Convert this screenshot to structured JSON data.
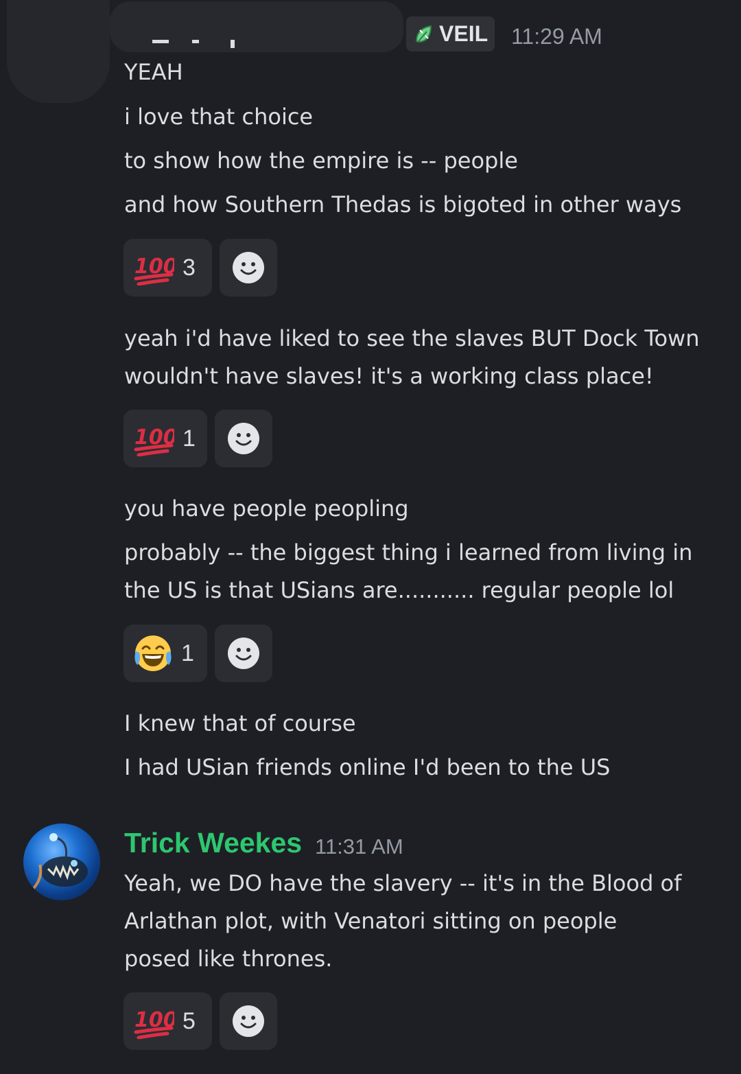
{
  "first_message": {
    "role_tag": "VEIL",
    "role_tag_icon": "leaf-badge-icon",
    "timestamp": "11:29 AM",
    "lines": [
      "YEAH",
      "i love that choice",
      "to show how the empire is -- people",
      "and how Southern Thedas is bigoted in other ways",
      "yeah i'd have liked to see the slaves BUT Dock Town",
      "wouldn't have slaves! it's a working class place!",
      "you have people peopling",
      "probably -- the biggest thing i learned from living in",
      "the US is that USians are........... regular people lol",
      "I knew that of course",
      "I had USian friends online I'd been to the US"
    ],
    "reactions": [
      {
        "emoji": "hundred-points-icon",
        "count": "3"
      },
      {
        "emoji": "hundred-points-icon",
        "count": "1"
      },
      {
        "emoji": "tears-of-joy-icon",
        "count": "1"
      }
    ]
  },
  "second_message": {
    "author": "Trick Weekes",
    "author_color": "#2dc770",
    "timestamp": "11:31 AM",
    "lines": [
      "Yeah, we DO have the slavery -- it's in the Blood of",
      "Arlathan plot, with Venatori sitting on people",
      "posed like thrones."
    ],
    "reactions": [
      {
        "emoji": "hundred-points-icon",
        "count": "5"
      }
    ]
  },
  "colors": {
    "background": "#1e1f24",
    "reaction_bg": "#2b2d33",
    "text": "#dbdee1",
    "muted": "#949ba4",
    "hundred_red": "#dd2e44"
  }
}
